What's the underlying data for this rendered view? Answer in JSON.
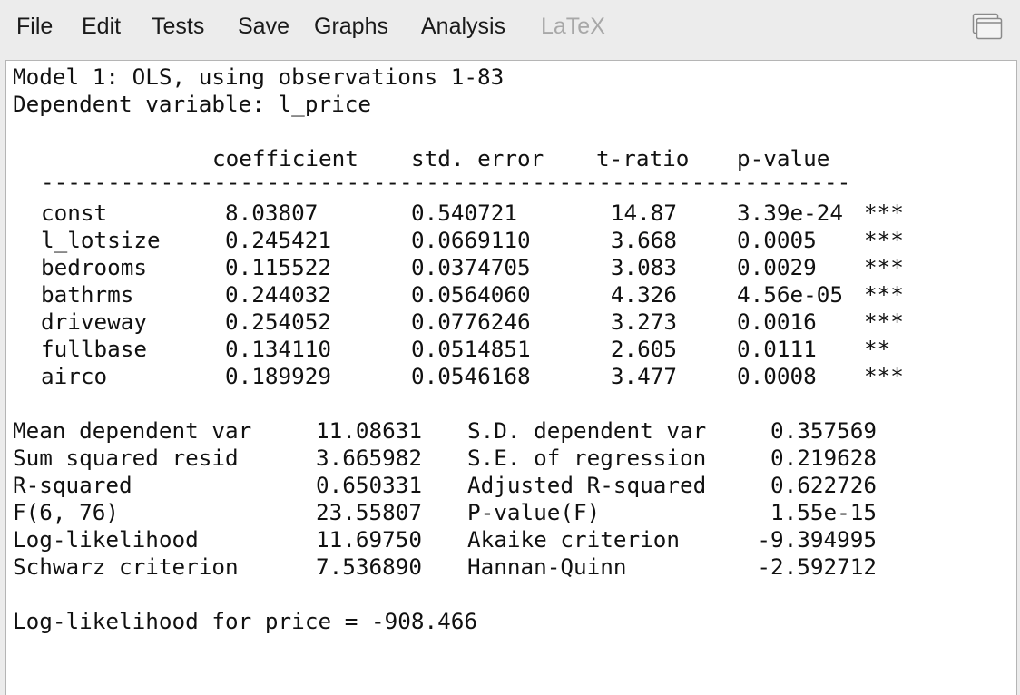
{
  "menu": {
    "file": "File",
    "edit": "Edit",
    "tests": "Tests",
    "save": "Save",
    "graphs": "Graphs",
    "analysis": "Analysis",
    "latex": "LaTeX"
  },
  "header": {
    "model_line": "Model 1: OLS, using observations 1-83",
    "dependent_line": "Dependent variable: l_price"
  },
  "table": {
    "col_coefficient": "coefficient",
    "col_std_error": "std. error",
    "col_t_ratio": "t-ratio",
    "col_p_value": "p-value",
    "rows": [
      {
        "name": "const",
        "coef": "8.03807",
        "se": "0.540721",
        "t": "14.87",
        "p": "3.39e-24",
        "stars": "***"
      },
      {
        "name": "l_lotsize",
        "coef": "0.245421",
        "se": "0.0669110",
        "t": "3.668",
        "p": "0.0005",
        "stars": "***"
      },
      {
        "name": "bedrooms",
        "coef": "0.115522",
        "se": "0.0374705",
        "t": "3.083",
        "p": "0.0029",
        "stars": "***"
      },
      {
        "name": "bathrms",
        "coef": "0.244032",
        "se": "0.0564060",
        "t": "4.326",
        "p": "4.56e-05",
        "stars": "***"
      },
      {
        "name": "driveway",
        "coef": "0.254052",
        "se": "0.0776246",
        "t": "3.273",
        "p": "0.0016",
        "stars": "***"
      },
      {
        "name": "fullbase",
        "coef": "0.134110",
        "se": "0.0514851",
        "t": "2.605",
        "p": "0.0111",
        "stars": "**"
      },
      {
        "name": "airco",
        "coef": "0.189929",
        "se": "0.0546168",
        "t": "3.477",
        "p": "0.0008",
        "stars": "***"
      }
    ]
  },
  "stats": [
    {
      "l_label": "Mean dependent var",
      "l_value": "11.08631",
      "r_label": "S.D. dependent var",
      "r_value": "0.357569"
    },
    {
      "l_label": "Sum squared resid",
      "l_value": "3.665982",
      "r_label": "S.E. of regression",
      "r_value": "0.219628"
    },
    {
      "l_label": "R-squared",
      "l_value": "0.650331",
      "r_label": "Adjusted R-squared",
      "r_value": "0.622726"
    },
    {
      "l_label": "F(6, 76)",
      "l_value": "23.55807",
      "r_label": "P-value(F)",
      "r_value": "1.55e-15"
    },
    {
      "l_label": "Log-likelihood",
      "l_value": "11.69750",
      "r_label": "Akaike criterion",
      "r_value": "-9.394995"
    },
    {
      "l_label": "Schwarz criterion",
      "l_value": "7.536890",
      "r_label": "Hannan-Quinn",
      "r_value": "-2.592712"
    }
  ],
  "footer": {
    "loglik_price": "Log-likelihood for price = -908.466"
  }
}
